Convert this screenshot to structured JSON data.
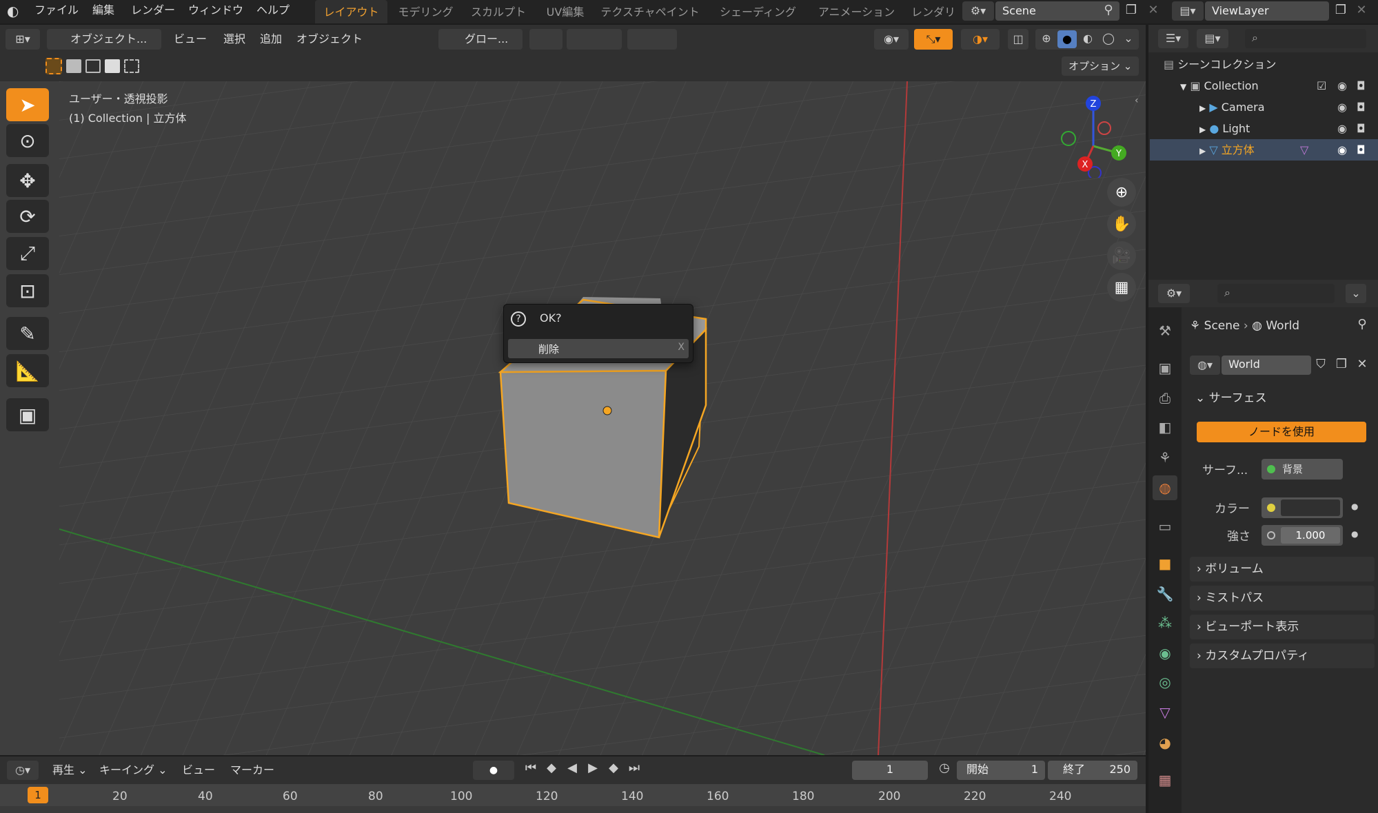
{
  "topbar": {
    "logo": "blender-logo-icon",
    "menus": [
      "ファイル",
      "編集",
      "レンダー",
      "ウィンドウ",
      "ヘルプ"
    ],
    "workspaces": [
      "レイアウト",
      "モデリング",
      "スカルプト",
      "UV編集",
      "テクスチャペイント",
      "シェーディング",
      "アニメーション",
      "レンダリ"
    ],
    "scene": "Scene",
    "viewlayer": "ViewLayer"
  },
  "header": {
    "mode": "オブジェクト...",
    "menus": [
      "ビュー",
      "選択",
      "追加",
      "オブジェクト"
    ],
    "transform": "グロー...",
    "options": "オプション"
  },
  "viewport": {
    "view_name": "ユーザー・透視投影",
    "collection_line": "(1) Collection | 立方体"
  },
  "dialog": {
    "title": "OK?",
    "item": "削除",
    "shortcut": "X"
  },
  "gizmo": {
    "x": "X",
    "y": "Y",
    "z": "Z"
  },
  "outliner": {
    "scene_collection": "シーンコレクション",
    "collection": "Collection",
    "items": [
      "Camera",
      "Light",
      "立方体"
    ]
  },
  "properties": {
    "breadcrumb_scene": "Scene",
    "breadcrumb_world": "World",
    "world_name": "World",
    "surface_section": "サーフェス",
    "use_nodes": "ノードを使用",
    "surface_label": "サーフ...",
    "surface_value": "背景",
    "color_label": "カラー",
    "strength_label": "強さ",
    "strength_value": "1.000",
    "sections": [
      "ボリューム",
      "ミストパス",
      "ビューポート表示",
      "カスタムプロパティ"
    ]
  },
  "timeline": {
    "menus": [
      "再生",
      "キーイング",
      "ビュー",
      "マーカー"
    ],
    "current_frame": "1",
    "start_label": "開始",
    "start_value": "1",
    "end_label": "終了",
    "end_value": "250",
    "ruler": [
      "1",
      "20",
      "40",
      "60",
      "80",
      "100",
      "120",
      "140",
      "160",
      "180",
      "200",
      "220",
      "240"
    ]
  },
  "colors": {
    "accent": "#f28e1c",
    "selected": "#f5a623",
    "x_axis": "#c43838",
    "y_axis": "#6aa633"
  }
}
